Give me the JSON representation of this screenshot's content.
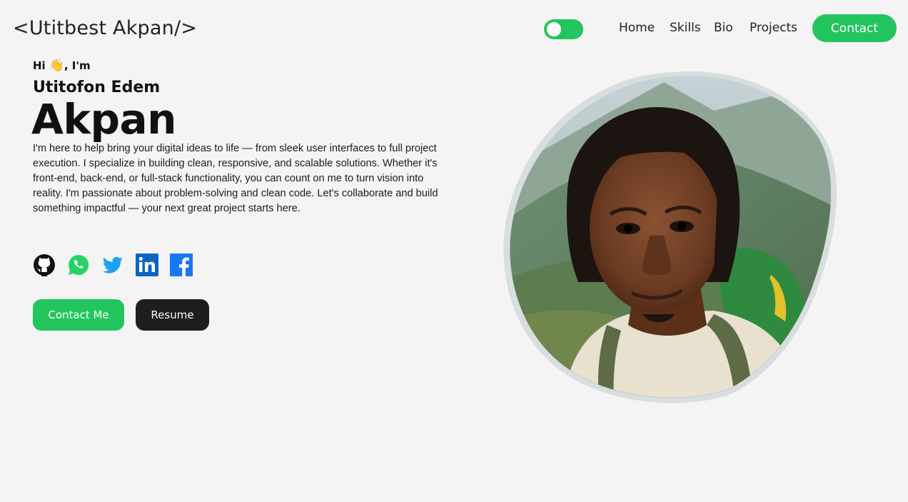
{
  "header": {
    "logo": "<Utitbest Akpan/>",
    "theme_toggle_state": "on",
    "nav": [
      {
        "label": "Home"
      },
      {
        "label": "Skills"
      },
      {
        "label": "Bio"
      },
      {
        "label": "Projects"
      }
    ],
    "contact_label": "Contact"
  },
  "hero": {
    "greeting_hi": "Hi",
    "greeting_emoji": "👋",
    "greeting_im": ", I'm",
    "first_names": "Utitofon Edem",
    "last_name": "Akpan",
    "bio": "I'm here to help bring your digital ideas to life — from sleek user interfaces to full project execution. I specialize in building clean, responsive, and scalable solutions. Whether it's front-end, back-end, or full-stack functionality, you can count on me to turn vision into reality. I'm passionate about problem-solving and clean code. Let's collaborate and build something impactful — your next great project starts here.",
    "socials": [
      "github-icon",
      "whatsapp-icon",
      "twitter-icon",
      "linkedin-icon",
      "facebook-icon"
    ],
    "buttons": {
      "contact": "Contact Me",
      "resume": "Resume"
    }
  },
  "colors": {
    "accent": "#22c55e",
    "dark_button": "#1e1e1e",
    "background": "#f4f4f4"
  }
}
